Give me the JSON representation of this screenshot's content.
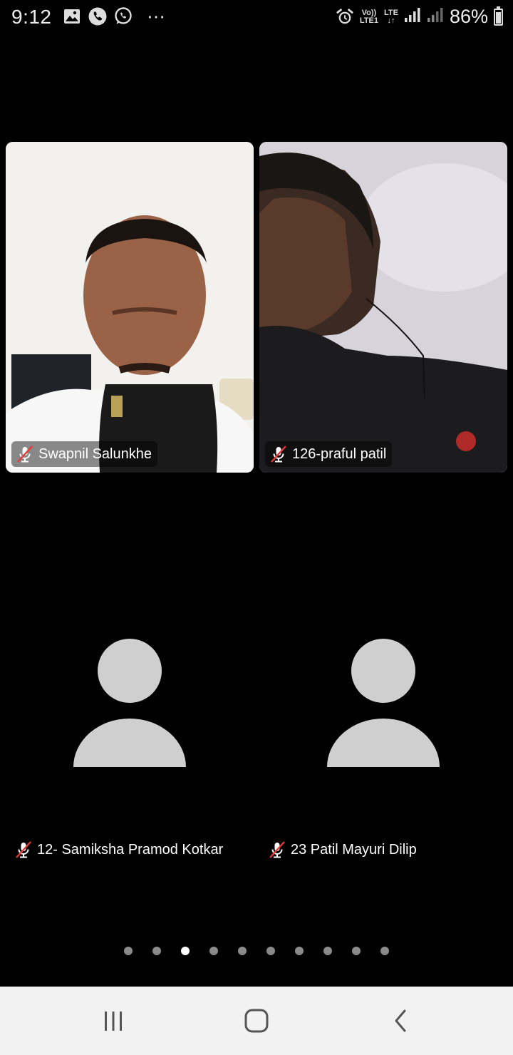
{
  "status_bar": {
    "time": "9:12",
    "left_icons": [
      "gallery-icon",
      "phone-call-icon",
      "whatsapp-icon"
    ],
    "more": "⋯",
    "volte_top": "Vo))",
    "volte_bottom": "LTE1",
    "lte_top": "LTE",
    "lte_bottom": "↓↑",
    "battery_percent": "86%",
    "battery_level": 0.86
  },
  "participants": [
    {
      "name": "Swapnil Salunkhe",
      "muted": true,
      "video": true
    },
    {
      "name": "126-praful patil",
      "muted": true,
      "video": true
    },
    {
      "name": "12- Samiksha Pramod Kotkar",
      "muted": true,
      "video": false
    },
    {
      "name": "23 Patil Mayuri Dilip",
      "muted": true,
      "video": false
    }
  ],
  "pagination": {
    "total": 10,
    "active_index": 2
  },
  "nav_bar": {
    "recents": "recents-icon",
    "home": "home-icon",
    "back": "back-icon"
  },
  "colors": {
    "background": "#000000",
    "avatar": "#cfcfcf",
    "mute_slash": "#e53935",
    "nav_bar": "#f2f2f2"
  }
}
